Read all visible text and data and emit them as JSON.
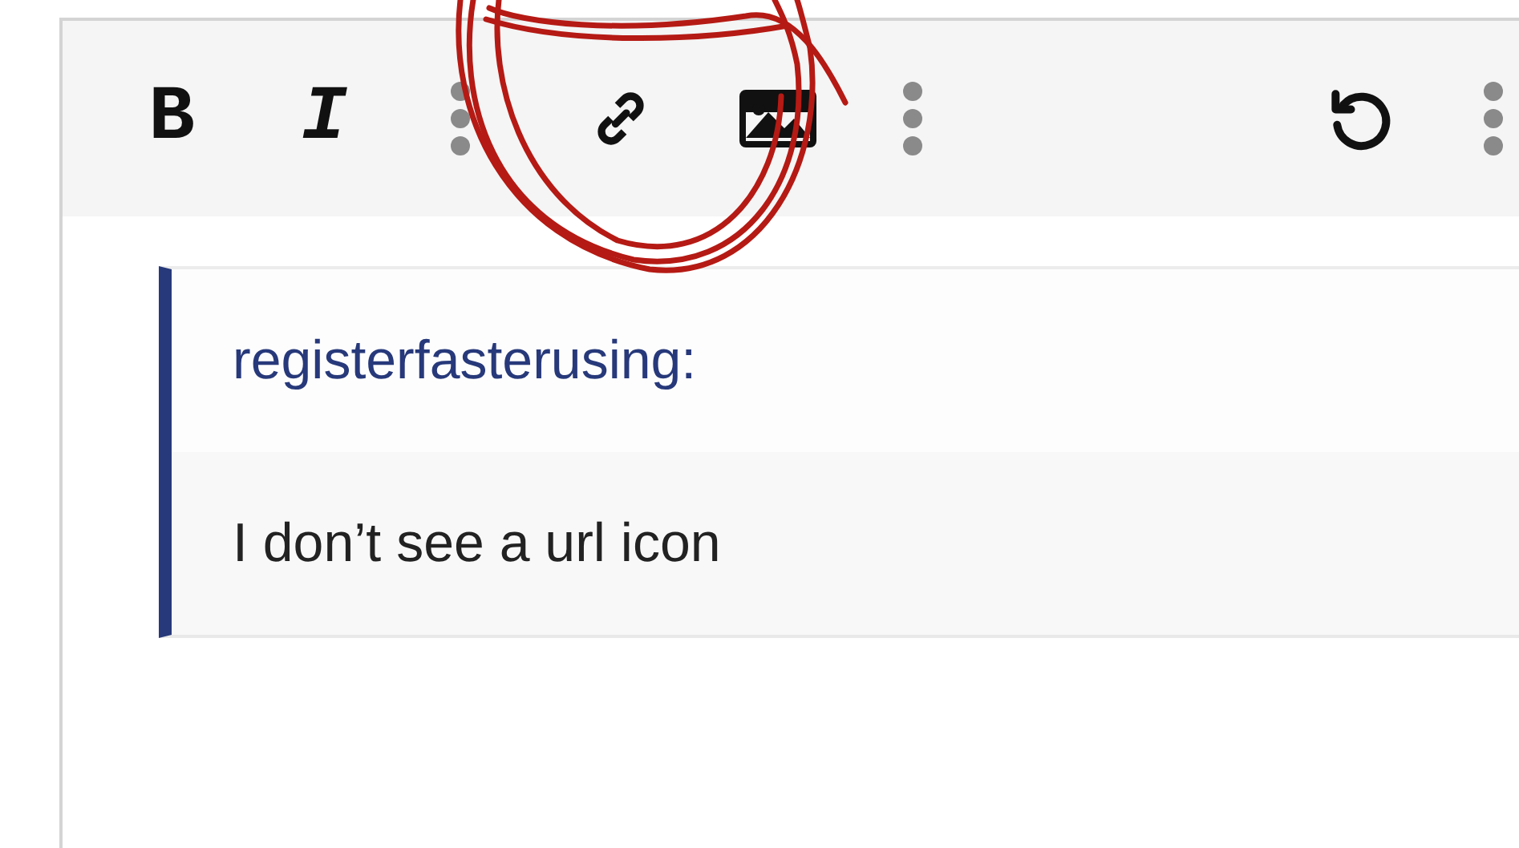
{
  "toolbar": [
    {
      "kind": "bold",
      "label": "B"
    },
    {
      "kind": "italic",
      "label": "I"
    },
    {
      "kind": "more"
    },
    {
      "kind": "link"
    },
    {
      "kind": "image"
    },
    {
      "kind": "more"
    },
    {
      "kind": "undo"
    },
    {
      "kind": "more"
    }
  ],
  "quote": {
    "author": "registerfasterusing:",
    "text": "I don’t see a url icon"
  }
}
